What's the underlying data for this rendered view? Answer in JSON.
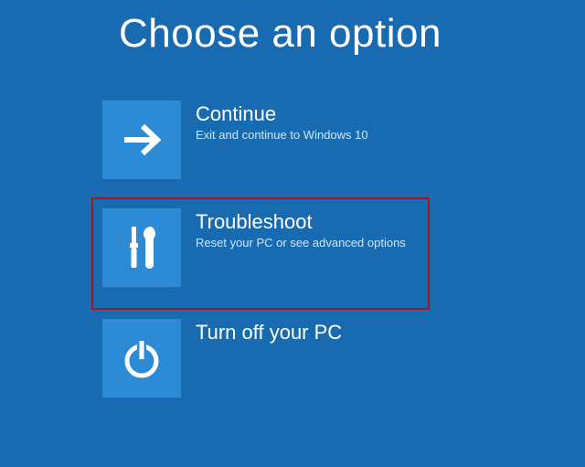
{
  "title": "Choose an option",
  "options": [
    {
      "id": "continue",
      "title": "Continue",
      "desc": "Exit and continue to Windows 10",
      "icon": "arrow-right-icon",
      "highlighted": false
    },
    {
      "id": "troubleshoot",
      "title": "Troubleshoot",
      "desc": "Reset your PC or see advanced options",
      "icon": "tools-icon",
      "highlighted": true
    },
    {
      "id": "turnoff",
      "title": "Turn off your PC",
      "desc": "",
      "icon": "power-icon",
      "highlighted": false
    }
  ]
}
